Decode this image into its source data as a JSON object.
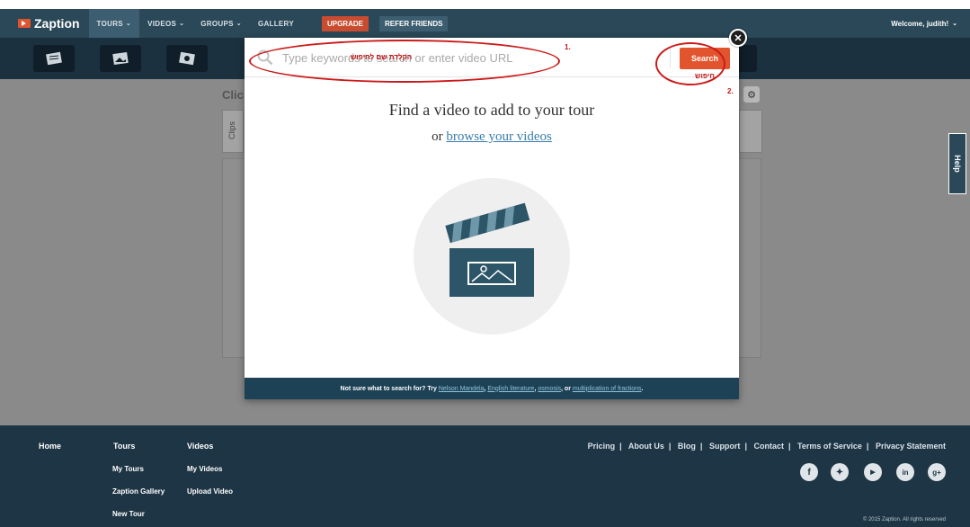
{
  "nav": {
    "logo": "Zaption",
    "items": [
      {
        "label": "TOURS"
      },
      {
        "label": "VIDEOS"
      },
      {
        "label": "GROUPS"
      },
      {
        "label": "GALLERY"
      }
    ],
    "upgrade": "UPGRADE",
    "refer": "REFER FRIENDS",
    "welcome": "Welcome, judith!"
  },
  "background": {
    "title_fragment": "Clic",
    "tab_label": "Clips",
    "help": "Help"
  },
  "modal": {
    "search_placeholder": "Type keywords to search or enter video URL",
    "search_button": "Search",
    "heading": "Find a video to add to your tour",
    "or_text": "or",
    "browse_link": "browse your videos",
    "footer": {
      "prefix": "Not sure what to search for? Try",
      "suggestions": [
        "Nelson Mandela",
        "English literature",
        "osmosis",
        "multiplication of fractions"
      ],
      "or_word": "or"
    }
  },
  "annotations": {
    "step1": "1.",
    "step2": "2.",
    "hebrew_search_box": "הקלדת שם לחיפוש",
    "hebrew_search_btn": "חיפוש",
    "color": "#cc1a1a"
  },
  "footer": {
    "home": "Home",
    "tours_head": "Tours",
    "tours": [
      "My Tours",
      "Zaption Gallery",
      "New Tour"
    ],
    "videos_head": "Videos",
    "videos": [
      "My Videos",
      "Upload Video"
    ],
    "links": [
      "Pricing",
      "About Us",
      "Blog",
      "Support",
      "Contact",
      "Terms of Service",
      "Privacy Statement"
    ],
    "social": [
      "facebook-icon",
      "twitter-icon",
      "youtube-icon",
      "linkedin-icon",
      "googleplus-icon"
    ],
    "copyright": "© 2015 Zaption. All rights reserved"
  },
  "colors": {
    "nav_bg": "#2a4858",
    "accent": "#e2542d",
    "modal_footer": "#1e4255",
    "footer_bg": "#1e3545"
  }
}
